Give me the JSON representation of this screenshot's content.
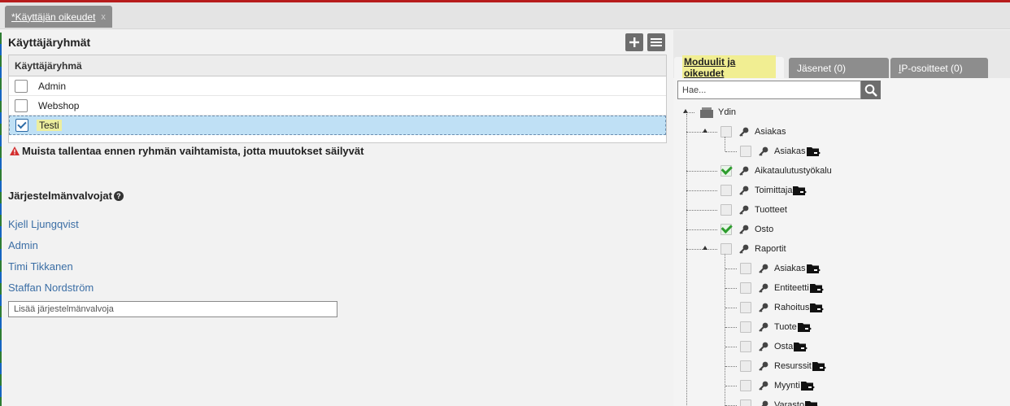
{
  "document_tab": {
    "title": "*Käyttäjän oikeudet",
    "close": "x"
  },
  "groups": {
    "title": "Käyttäjäryhmät",
    "add_icon": "plus-icon",
    "menu_icon": "menu-icon",
    "column_header": "Käyttäjäryhmä",
    "rows": [
      {
        "label": "Admin",
        "checked": false
      },
      {
        "label": "Webshop",
        "checked": false
      },
      {
        "label": "Testi",
        "checked": true
      }
    ],
    "warning": "Muista tallentaa ennen ryhmän vaihtamista, jotta muutokset säilyvät"
  },
  "admins": {
    "title": "Järjestelmänvalvojat",
    "help_icon": "help-icon",
    "people": [
      "Kjell Ljungqvist",
      "Admin",
      "Timi Tikkanen",
      "Staffan Nordström"
    ],
    "add_placeholder": "Lisää järjestelmänvalvoja"
  },
  "right_tabs": {
    "modules": "Moduulit ja oikeudet",
    "members": "Jäsenet (0)",
    "ip_prefix": "I",
    "ip_rest": "P-osoitteet (0)"
  },
  "search": {
    "placeholder": "Hae...",
    "icon": "search-icon"
  },
  "tree": {
    "root": "Ydin",
    "nodes": [
      {
        "label": "Asiakas",
        "level": 1,
        "checked": false,
        "folder": false,
        "expanded": true
      },
      {
        "label": "Asiakas",
        "level": 2,
        "checked": false,
        "folder": true
      },
      {
        "label": "Aikataulutustyökalu",
        "level": 1,
        "checked": true,
        "folder": false
      },
      {
        "label": "Toimittaja",
        "level": 1,
        "checked": false,
        "folder": true
      },
      {
        "label": "Tuotteet",
        "level": 1,
        "checked": false,
        "folder": false
      },
      {
        "label": "Osto",
        "level": 1,
        "checked": true,
        "folder": false
      },
      {
        "label": "Raportit",
        "level": 1,
        "checked": false,
        "folder": false,
        "expanded": true
      },
      {
        "label": "Asiakas",
        "level": 2,
        "checked": false,
        "folder": true
      },
      {
        "label": "Entiteetti",
        "level": 2,
        "checked": false,
        "folder": true
      },
      {
        "label": "Rahoitus",
        "level": 2,
        "checked": false,
        "folder": true
      },
      {
        "label": "Tuote",
        "level": 2,
        "checked": false,
        "folder": true
      },
      {
        "label": "Osta",
        "level": 2,
        "checked": false,
        "folder": true
      },
      {
        "label": "Resurssit",
        "level": 2,
        "checked": false,
        "folder": true
      },
      {
        "label": "Myynti",
        "level": 2,
        "checked": false,
        "folder": true
      },
      {
        "label": "Varasto",
        "level": 2,
        "checked": false,
        "folder": true
      }
    ]
  }
}
